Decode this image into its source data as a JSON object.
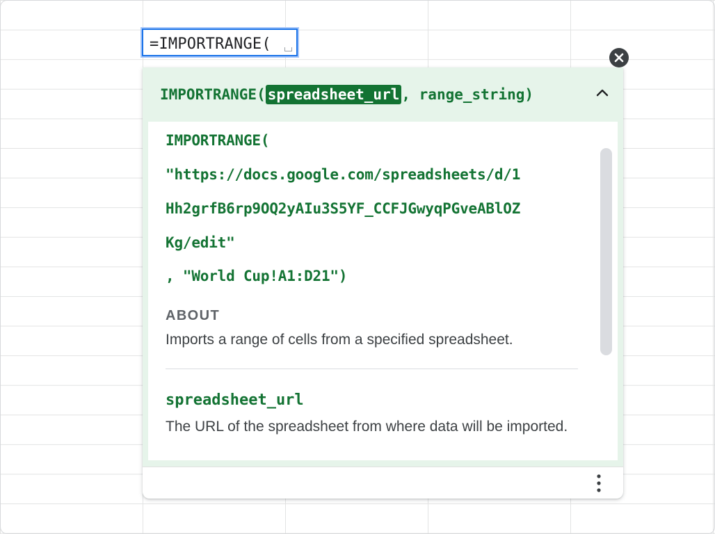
{
  "cell": {
    "formula_text": "=IMPORTRANGE("
  },
  "help_card": {
    "signature": {
      "function_name": "IMPORTRANGE(",
      "active_param": "spreadsheet_url",
      "rest": ", range_string)"
    },
    "example": {
      "lines": [
        "IMPORTRANGE(",
        "\"https://docs.google.com/spreadsheets/d/1",
        "Hh2grfB6rp9OQ2yAIu3S5YF_CCFJGwyqPGveABlOZ",
        "Kg/edit\"",
        ", \"World Cup!A1:D21\")"
      ]
    },
    "about": {
      "label": "ABOUT",
      "text": "Imports a range of cells from a specified spreadsheet."
    },
    "parameter": {
      "name": "spreadsheet_url",
      "description": "The URL of the spreadsheet from where data will be imported."
    }
  },
  "icons": {
    "close": "close-icon",
    "collapse": "chevron-up-icon",
    "more": "more-vert-icon"
  },
  "colors": {
    "accent_green": "#137333",
    "card_background": "#e6f4ea",
    "cell_border": "#1a73e8"
  }
}
